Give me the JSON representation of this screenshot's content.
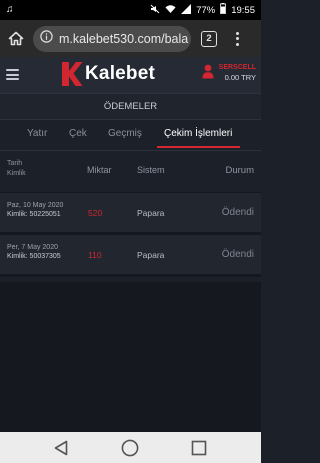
{
  "status_bar": {
    "battery": "77%",
    "time": "19:55"
  },
  "browser": {
    "url": "m.kalebet530.com/bala",
    "tab_count": "2"
  },
  "site": {
    "logo_text": "Kalebet",
    "username": "SERSCELL",
    "balance": "0.00 TRY",
    "accent_color": "#d22630"
  },
  "page": {
    "title": "ÖDEMELER",
    "tabs": [
      {
        "label": "Yatır"
      },
      {
        "label": "Çek"
      },
      {
        "label": "Geçmiş"
      },
      {
        "label": "Çekim İşlemleri"
      }
    ],
    "active_tab": "Çekim İşlemleri"
  },
  "table": {
    "headers": {
      "date": "Tarih",
      "id": "Kimlik",
      "amount": "Miktar",
      "system": "Sistem",
      "status": "Durum"
    },
    "rows": [
      {
        "date": "Paz, 10 May 2020",
        "id": "Kimlik: 50225051",
        "amount": "520",
        "system": "Papara",
        "status": "Ödendi"
      },
      {
        "date": "Per, 7 May 2020",
        "id": "Kimlik: 50037305",
        "amount": "110",
        "system": "Papara",
        "status": "Ödendi"
      }
    ]
  }
}
